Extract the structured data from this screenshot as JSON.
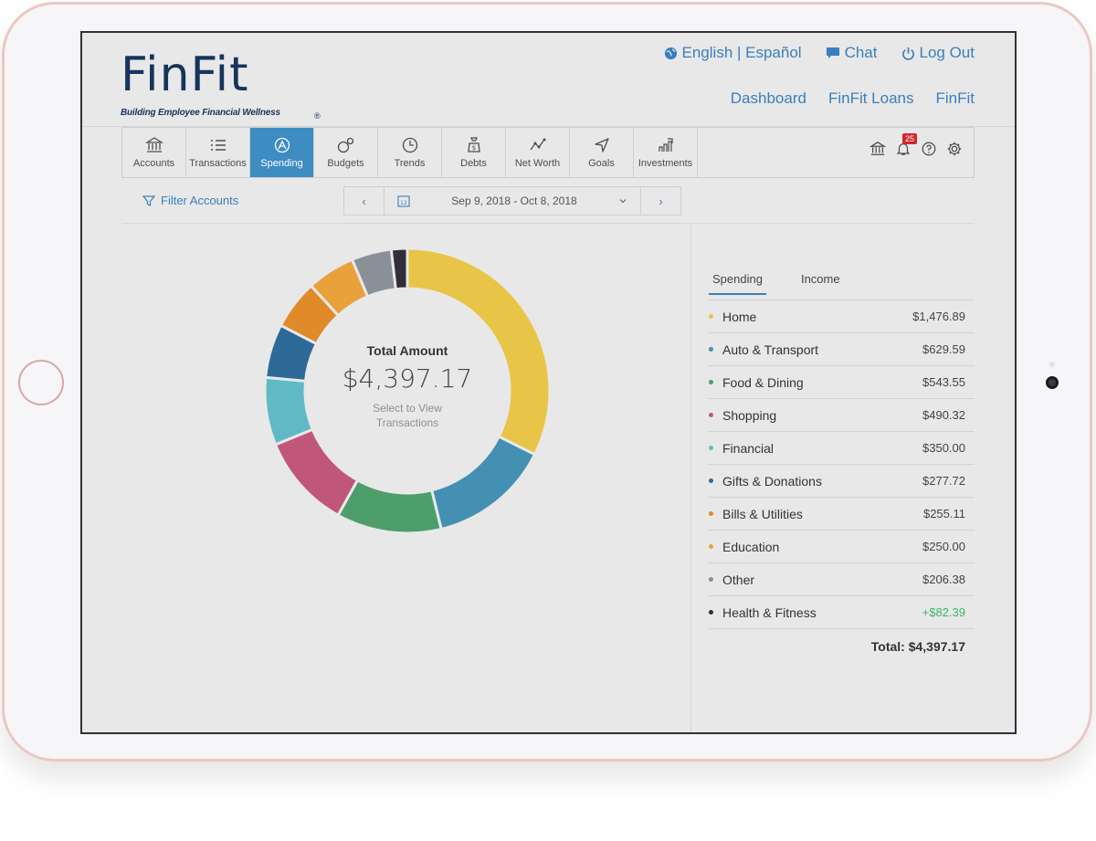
{
  "brand": {
    "name": "FinFit",
    "registered": "®",
    "tagline": "Building Employee Financial Wellness"
  },
  "top_links": {
    "language": "English | Español",
    "chat": "Chat",
    "logout": "Log Out"
  },
  "main_nav": [
    "Dashboard",
    "FinFit Loans",
    "FinFit"
  ],
  "tabs": [
    {
      "label": "Accounts",
      "icon": "bank-icon",
      "active": false
    },
    {
      "label": "Transactions",
      "icon": "list-icon",
      "active": false
    },
    {
      "label": "Spending",
      "icon": "spending-icon",
      "active": true
    },
    {
      "label": "Budgets",
      "icon": "budgets-icon",
      "active": false
    },
    {
      "label": "Trends",
      "icon": "clock-icon",
      "active": false
    },
    {
      "label": "Debts",
      "icon": "debt-bag-icon",
      "active": false
    },
    {
      "label": "Net Worth",
      "icon": "line-graph-icon",
      "active": false
    },
    {
      "label": "Goals",
      "icon": "navigation-arrow-icon",
      "active": false
    },
    {
      "label": "Investments",
      "icon": "investments-icon",
      "active": false
    }
  ],
  "toolbar": {
    "notification_count": "25"
  },
  "filter": {
    "label": "Filter Accounts"
  },
  "date_range": {
    "label": "Sep 9, 2018 - Oct 8, 2018",
    "calendar_day": "12",
    "prev": "‹",
    "next": "›"
  },
  "center": {
    "title": "Total Amount",
    "amount": "$4,397.17",
    "hint_line1": "Select to View",
    "hint_line2": "Transactions"
  },
  "subtabs": [
    {
      "label": "Spending",
      "active": true
    },
    {
      "label": "Income",
      "active": false
    }
  ],
  "categories": [
    {
      "name": "Home",
      "amount": "$1,476.89",
      "color": "#e8c547",
      "value": 1476.89
    },
    {
      "name": "Auto & Transport",
      "amount": "$629.59",
      "color": "#4490b2",
      "value": 629.59
    },
    {
      "name": "Food & Dining",
      "amount": "$543.55",
      "color": "#4e9e6c",
      "value": 543.55
    },
    {
      "name": "Shopping",
      "amount": "$490.32",
      "color": "#c0577a",
      "value": 490.32
    },
    {
      "name": "Financial",
      "amount": "$350.00",
      "color": "#5fbac6",
      "value": 350.0
    },
    {
      "name": "Gifts & Donations",
      "amount": "$277.72",
      "color": "#2e6a97",
      "value": 277.72
    },
    {
      "name": "Bills & Utilities",
      "amount": "$255.11",
      "color": "#e08a2a",
      "value": 255.11
    },
    {
      "name": "Education",
      "amount": "$250.00",
      "color": "#e8a13b",
      "value": 250.0
    },
    {
      "name": "Other",
      "amount": "$206.38",
      "color": "#8a9098",
      "value": 206.38
    },
    {
      "name": "Health & Fitness",
      "amount": "+$82.39",
      "color": "#2f2f3c",
      "value": 82.39,
      "positive": true
    }
  ],
  "total": {
    "label": "Total: $4,397.17"
  }
}
